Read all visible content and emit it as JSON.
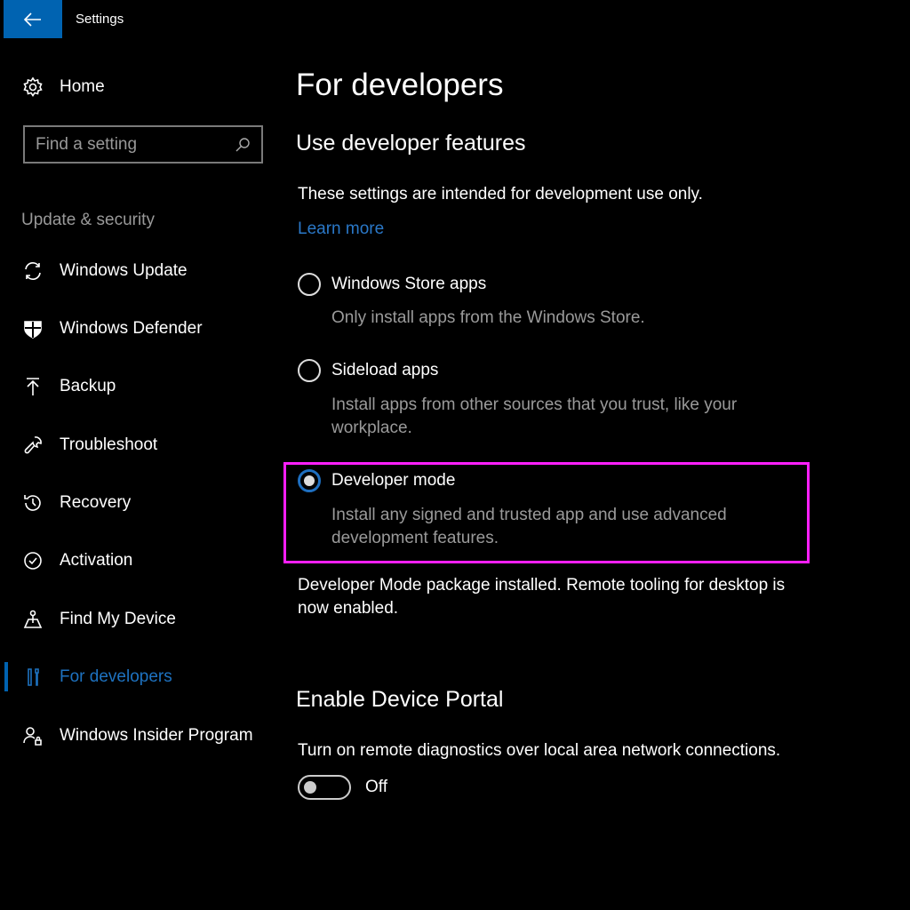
{
  "window": {
    "title": "Settings"
  },
  "sidebar": {
    "home": "Home",
    "search": {
      "placeholder": "Find a setting"
    },
    "section": "Update & security",
    "items": [
      {
        "label": "Windows Update",
        "icon": "sync-icon"
      },
      {
        "label": "Windows Defender",
        "icon": "shield-icon"
      },
      {
        "label": "Backup",
        "icon": "upload-icon"
      },
      {
        "label": "Troubleshoot",
        "icon": "wrench-icon"
      },
      {
        "label": "Recovery",
        "icon": "history-icon"
      },
      {
        "label": "Activation",
        "icon": "check-circle-icon"
      },
      {
        "label": "Find My Device",
        "icon": "location-icon"
      },
      {
        "label": "For developers",
        "icon": "developer-tools-icon",
        "active": true
      },
      {
        "label": "Windows Insider Program",
        "icon": "insider-icon"
      }
    ]
  },
  "main": {
    "title": "For developers",
    "section1": "Use developer features",
    "intro": "These settings are intended for development use only.",
    "learn_more": "Learn more",
    "options": [
      {
        "label": "Windows Store apps",
        "desc": "Only install apps from the Windows Store.",
        "selected": false
      },
      {
        "label": "Sideload apps",
        "desc1": "Install apps from other sources that you trust, like your",
        "desc2": "workplace.",
        "selected": false
      },
      {
        "label": "Developer mode",
        "desc1": "Install any signed and trusted app and use advanced",
        "desc2": "development features.",
        "selected": true
      }
    ],
    "status1": "Developer Mode package installed.  Remote tooling for desktop is",
    "status2": "now enabled.",
    "section2": "Enable Device Portal",
    "portal_desc": "Turn on remote diagnostics over local area network connections.",
    "toggle_state": "Off"
  },
  "colors": {
    "accent": "#0063b1",
    "highlight": "#ff1fff"
  }
}
